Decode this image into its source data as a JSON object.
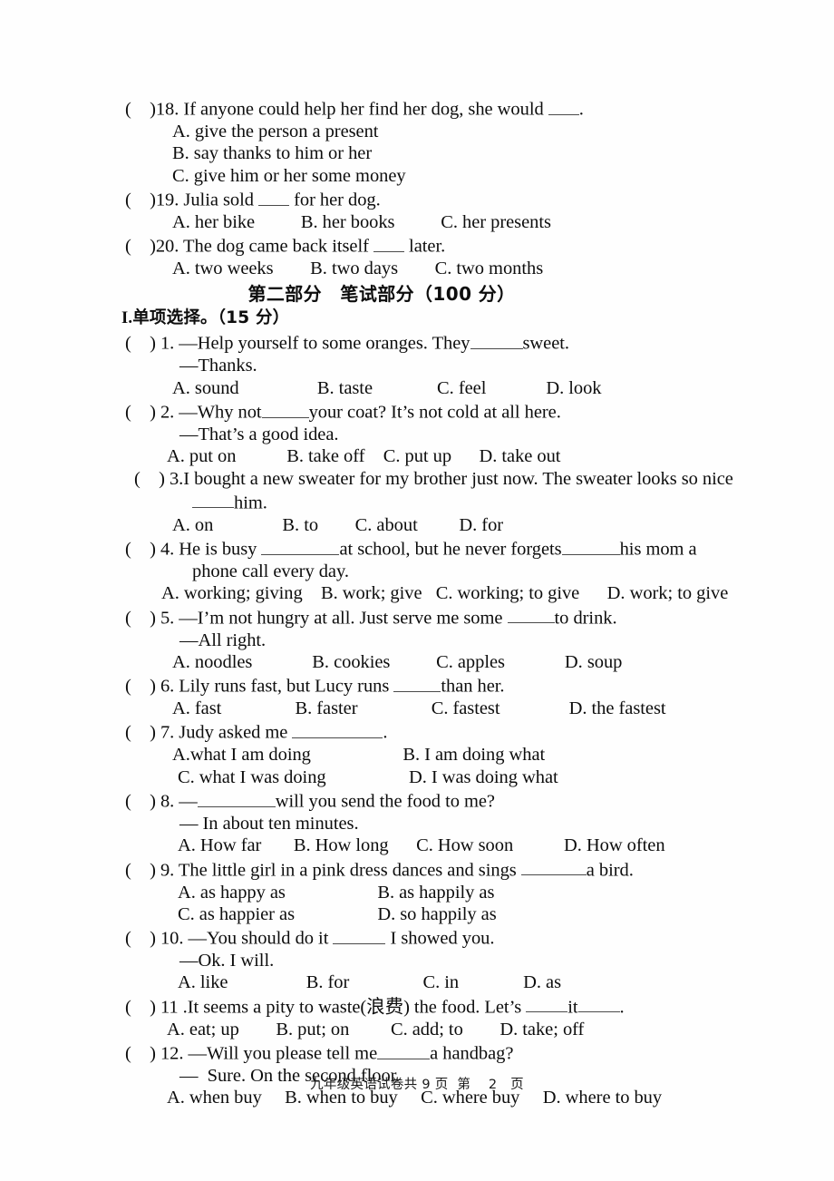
{
  "document": {
    "page_footer": "九年级英语试卷共 9 页  第    2   页",
    "part_heading": "第二部分　笔试部分（100 分）",
    "section_heading_prefix": "I.",
    "section_heading": "单项选择。（15 分）"
  },
  "carryover_questions": [
    {
      "marker": "(    )",
      "number": "18.",
      "stem": " If anyone could help her find her dog, she would ",
      "stem_tail": ".",
      "options_rows": [
        [
          "A. give the person a present"
        ],
        [
          "B. say thanks to him or her"
        ],
        [
          "C. give him or her some money"
        ]
      ]
    },
    {
      "marker": "(    )",
      "number": "19.",
      "stem": " Julia sold ",
      "stem_tail": " for her dog.",
      "options_rows": [
        [
          "A. her bike",
          "B. her books",
          "C. her presents"
        ]
      ]
    },
    {
      "marker": "(    )",
      "number": "20.",
      "stem": " The dog came back itself ",
      "stem_tail": " later.",
      "options_rows": [
        [
          "A. two weeks",
          "B. two days",
          "C. two months"
        ]
      ]
    }
  ],
  "questions": [
    {
      "marker": "(    ) ",
      "number": "1.",
      "stem_a": " —Help yourself to some oranges. They",
      "stem_b": "sweet.",
      "reply": "—Thanks.",
      "options": "A. sound                 B. taste              C. feel             D. look"
    },
    {
      "marker": "(    ) ",
      "number": "2.",
      "stem_a": " —Why not",
      "stem_b": "your coat? It’s not cold at all here.",
      "reply": "—That’s a good idea.",
      "options": "A. put on           B. take off    C. put up      D. take out"
    },
    {
      "marker": "(    ) ",
      "number": "3.",
      "stem_a": "I bought a new sweater for my brother just now. The sweater looks so nice",
      "cont_b": "him.",
      "options": "A. on               B. to        C. about         D. for"
    },
    {
      "marker": "(    ) ",
      "number": "4.",
      "stem_a": " He is busy ",
      "stem_b": "at school, but he never forgets",
      "stem_c": "his mom a",
      "cont": "phone call every day.",
      "options": "A. working; giving    B. work; give   C. working; to give      D. work; to give"
    },
    {
      "marker": "(    ) ",
      "number": "5.",
      "stem_a": " —I’m not hungry at all. Just serve me some ",
      "stem_b": "to drink.",
      "reply": "—All right.",
      "options": "A. noodles             B. cookies          C. apples             D. soup"
    },
    {
      "marker": "(    ) ",
      "number": "6.",
      "stem_a": " Lily runs fast, but Lucy runs ",
      "stem_b": "than her.",
      "options": "A. fast                B. faster                C. fastest               D. the fastest"
    },
    {
      "marker": "(    ) ",
      "number": "7.",
      "stem_a": " Judy asked me ",
      "stem_b": ".",
      "options_rows": [
        "A.what I am doing                    B. I am doing what",
        "C. what I was doing                  D. I was doing what"
      ]
    },
    {
      "marker": "(    ) ",
      "number": "8.",
      "stem_a": " —",
      "stem_b": "will you send the food to me?",
      "reply": "— In about ten minutes.",
      "options": "A. How far       B. How long      C. How soon           D. How often"
    },
    {
      "marker": "(    ) ",
      "number": "9.",
      "stem_a": " The little girl in a pink dress dances and sings ",
      "stem_b": "a bird.",
      "options_rows": [
        "A. as happy as                    B. as happily as",
        "C. as happier as                  D. so happily as"
      ]
    },
    {
      "marker": "(    ) ",
      "number": "10.",
      "stem_a": " —You should do it ",
      "stem_b": " I showed you.",
      "reply": "—Ok. I will.",
      "options": "A. like                 B. for                C. in              D. as"
    },
    {
      "marker": "(    ) ",
      "number": "11 .",
      "stem_a": "It seems a pity to waste(浪费) the food. Let’s ",
      "stem_mid": "it",
      "stem_b": ".",
      "options": "A. eat; up        B. put; on         C. add; to        D. take; off"
    },
    {
      "marker": "(    ) ",
      "number": "12.",
      "stem_a": " —Will you please tell me",
      "stem_b": "a handbag?",
      "reply": "—  Sure. On the second floor.",
      "options": "A. when buy     B. when to buy     C. where buy     D. where to buy"
    }
  ]
}
